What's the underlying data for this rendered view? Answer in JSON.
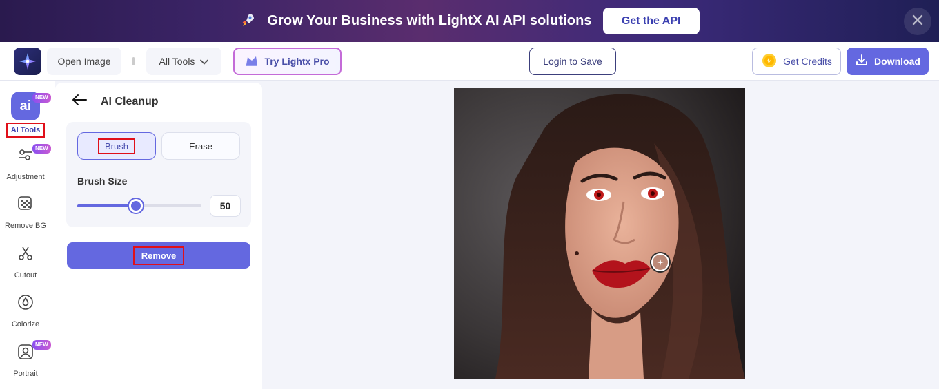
{
  "banner": {
    "icon": "rocket-icon",
    "text": "Grow Your Business with LightX AI API solutions",
    "cta_label": "Get the API"
  },
  "toolbar": {
    "open_image": "Open Image",
    "all_tools": "All Tools",
    "try_pro": "Try Lightx Pro",
    "login_save": "Login to Save",
    "get_credits": "Get Credits",
    "download": "Download"
  },
  "sidebar": {
    "items": [
      {
        "label": "AI Tools",
        "icon": "ai-icon",
        "badge": "NEW",
        "active": true
      },
      {
        "label": "Adjustment",
        "icon": "adjustment-icon",
        "badge": "NEW"
      },
      {
        "label": "Remove BG",
        "icon": "remove-bg-icon"
      },
      {
        "label": "Cutout",
        "icon": "scissors-icon"
      },
      {
        "label": "Colorize",
        "icon": "droplet-icon"
      },
      {
        "label": "Portrait",
        "icon": "portrait-icon",
        "badge": "NEW"
      }
    ]
  },
  "panel": {
    "title": "AI Cleanup",
    "modes": {
      "brush": "Brush",
      "erase": "Erase",
      "active": "brush"
    },
    "brush_size_label": "Brush Size",
    "brush_size_value": "50",
    "brush_size_fraction": 0.47,
    "remove_label": "Remove"
  },
  "colors": {
    "accent": "#6468e0",
    "highlight_box": "#e0101a",
    "banner_bg": "#3b2466"
  }
}
